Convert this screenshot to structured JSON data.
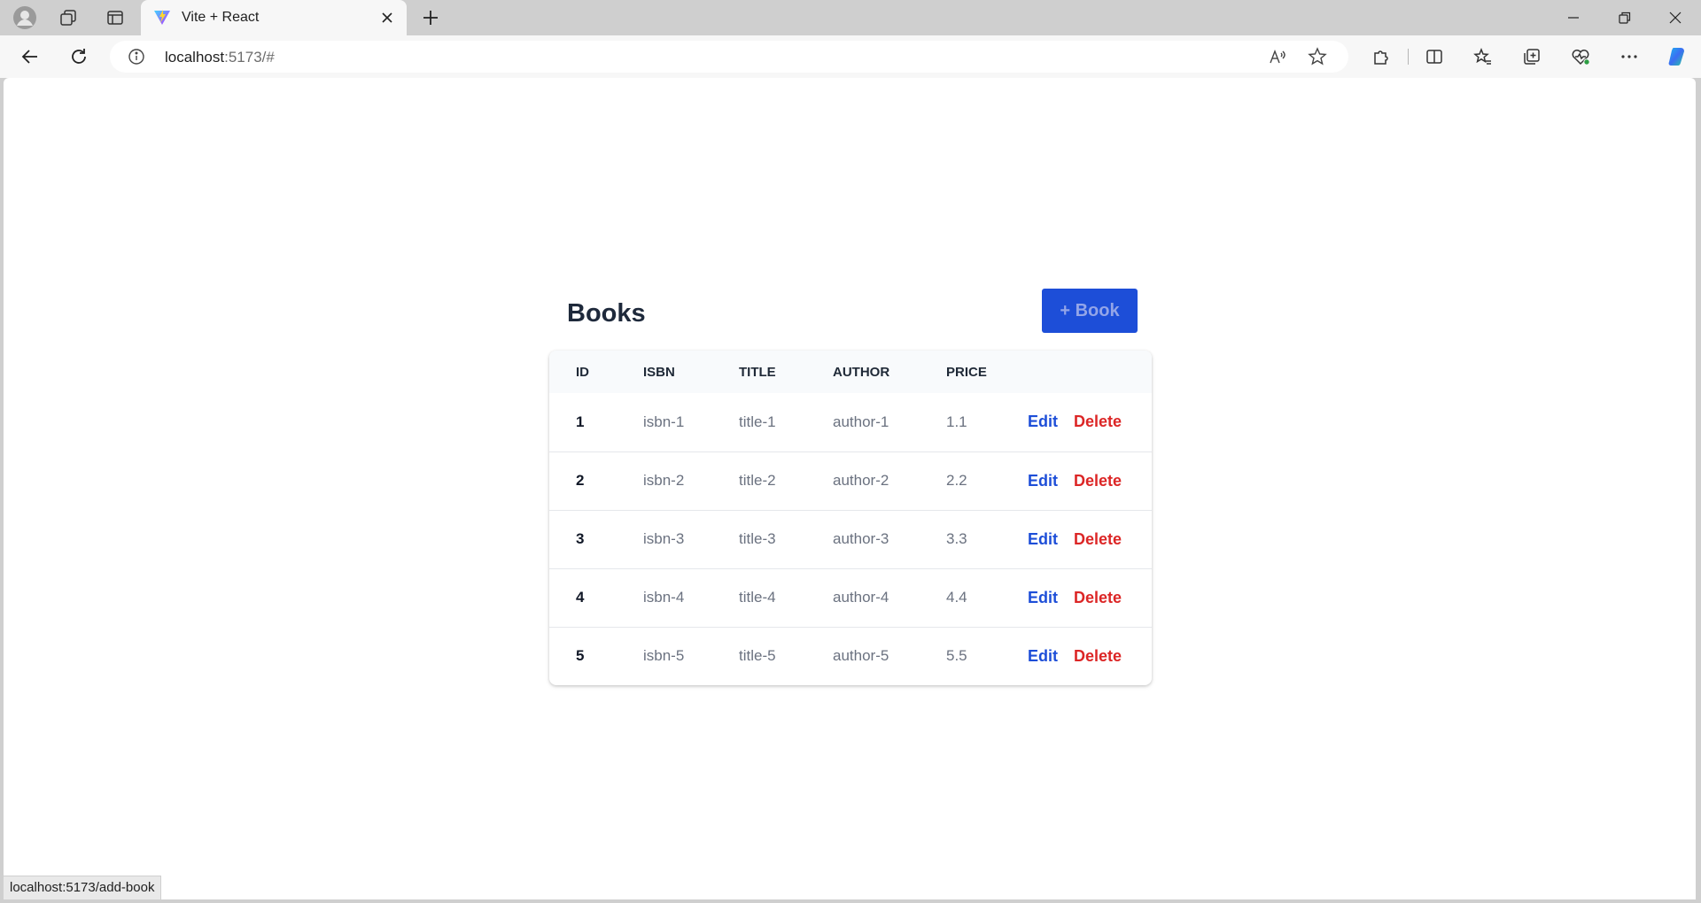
{
  "browser": {
    "tab": {
      "title": "Vite + React"
    },
    "address": {
      "host": "localhost",
      "rest": ":5173/#"
    },
    "status_url": "localhost:5173/add-book"
  },
  "app": {
    "title": "Books",
    "add_button": "+ Book",
    "columns": [
      "ID",
      "ISBN",
      "TITLE",
      "AUTHOR",
      "PRICE"
    ],
    "rows": [
      {
        "id": "1",
        "isbn": "isbn-1",
        "title": "title-1",
        "author": "author-1",
        "price": "1.1"
      },
      {
        "id": "2",
        "isbn": "isbn-2",
        "title": "title-2",
        "author": "author-2",
        "price": "2.2"
      },
      {
        "id": "3",
        "isbn": "isbn-3",
        "title": "title-3",
        "author": "author-3",
        "price": "3.3"
      },
      {
        "id": "4",
        "isbn": "isbn-4",
        "title": "title-4",
        "author": "author-4",
        "price": "4.4"
      },
      {
        "id": "5",
        "isbn": "isbn-5",
        "title": "title-5",
        "author": "author-5",
        "price": "5.5"
      }
    ],
    "edit_label": "Edit",
    "delete_label": "Delete"
  },
  "colors": {
    "primary": "#1d4ed8",
    "danger": "#dc2626",
    "heading": "#1e293b",
    "muted_text": "#6b7280"
  },
  "icons": [
    "profile-icon",
    "workspaces-icon",
    "vertical-tabs-icon",
    "vite-logo-icon",
    "close-icon",
    "plus-icon",
    "back-icon",
    "refresh-icon",
    "info-icon",
    "read-aloud-icon",
    "favorite-star-icon",
    "extensions-icon",
    "split-screen-icon",
    "favorites-icon",
    "collections-icon",
    "browser-essentials-icon",
    "more-icon",
    "copilot-icon",
    "minimize-icon",
    "restore-icon"
  ]
}
